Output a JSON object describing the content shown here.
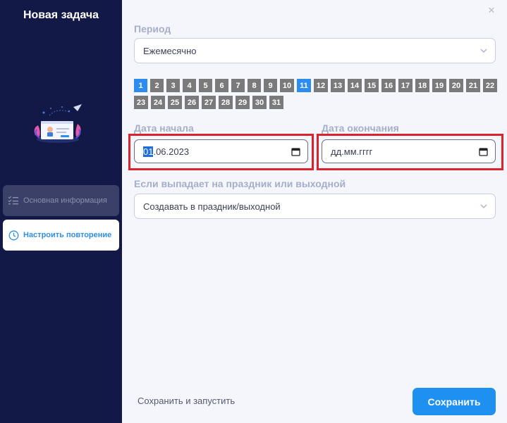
{
  "sidebar": {
    "title": "Новая задача",
    "items": [
      {
        "label": "Основная информация",
        "icon": "list-icon",
        "active": false
      },
      {
        "label": "Настроить повторение",
        "icon": "clock-icon",
        "active": true
      }
    ]
  },
  "form": {
    "period": {
      "label": "Период",
      "value": "Ежемесячно"
    },
    "days": {
      "values": [
        "1",
        "2",
        "3",
        "4",
        "5",
        "6",
        "7",
        "8",
        "9",
        "10",
        "11",
        "12",
        "13",
        "14",
        "15",
        "16",
        "17",
        "18",
        "19",
        "20",
        "21",
        "22",
        "23",
        "24",
        "25",
        "26",
        "27",
        "28",
        "29",
        "30",
        "31"
      ],
      "selected": [
        "1",
        "11"
      ]
    },
    "start_date": {
      "label": "Дата начала",
      "day": "01",
      "rest": ".06.2023"
    },
    "end_date": {
      "label": "Дата окончания",
      "placeholder": "дд.мм.гггг"
    },
    "holiday": {
      "label": "Если выпадает на праздник или выходной",
      "value": "Создавать в праздник/выходной"
    }
  },
  "footer": {
    "save_and_run_label": "Сохранить и запустить",
    "save_label": "Сохранить"
  },
  "colors": {
    "sidebar_bg": "#131947",
    "accent": "#1e90f0",
    "highlight_frame": "#d9232d"
  }
}
